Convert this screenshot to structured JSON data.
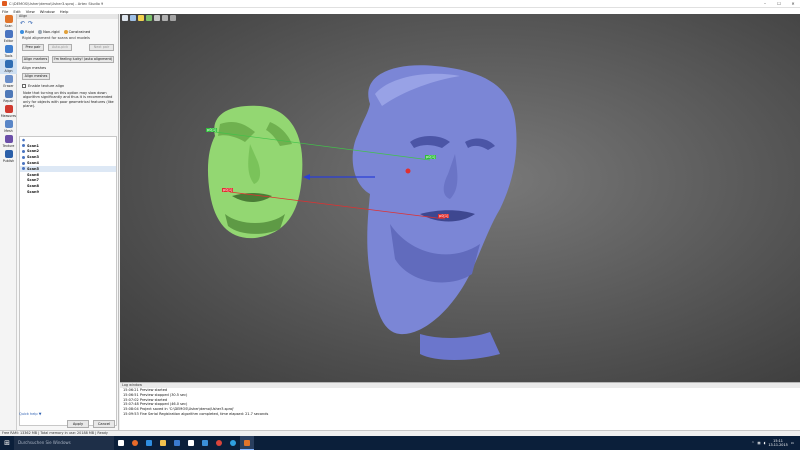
{
  "window": {
    "title": "C:\\DEMOS\\Usher\\demo\\Usher3.sproj - Artec Studio 9",
    "controls": [
      "–",
      "☐",
      "✕"
    ]
  },
  "menu": [
    "File",
    "Edit",
    "View",
    "Window",
    "Help"
  ],
  "tools": [
    {
      "label": "Scan",
      "icon": "scan-icon",
      "color": "#e0742a"
    },
    {
      "label": "Editor",
      "icon": "editor-icon",
      "color": "#4a74c0"
    },
    {
      "label": "Tools",
      "icon": "tools-icon",
      "color": "#3f7fcf"
    },
    {
      "label": "Align",
      "icon": "align-icon",
      "color": "#2f6db3"
    },
    {
      "label": "Eraser",
      "icon": "eraser-icon",
      "color": "#6a8ec9"
    },
    {
      "label": "Repair",
      "icon": "repair-icon",
      "color": "#4f79b8"
    },
    {
      "label": "Measures",
      "icon": "measures-icon",
      "color": "#d13a2f"
    },
    {
      "label": "Mesh",
      "icon": "mesh-icon",
      "color": "#5a86c7"
    },
    {
      "label": "Texture",
      "icon": "texture-icon",
      "color": "#6b4ea8"
    },
    {
      "label": "Publish",
      "icon": "publish-icon",
      "color": "#2b5fa8"
    }
  ],
  "panel": {
    "header": "Align",
    "modes": [
      {
        "label": "Rigid",
        "color": "#3a8ee0"
      },
      {
        "label": "Non-rigid",
        "color": "#9aa7b4"
      },
      {
        "label": "Constrained",
        "color": "#e0a03a"
      }
    ],
    "subtitle": "Rigid alignment for scans and models",
    "pair_buttons": [
      "Prev pair",
      "Auto-pick",
      "Next pair"
    ],
    "align_markers_btn": "Align markers",
    "feeling_lucky_btn": "I'm feeling lucky! (auto alignment)",
    "align_meshes_label": "Align meshes",
    "align_meshes_btn": "Align meshes",
    "texture_align_label": "Enable texture align",
    "note": "Note that turning on this option may slow down algorithm significantly and thus it is recommended only for objects with poor geometrical features (like plane).",
    "tree_header": "●",
    "scans": [
      {
        "name": "Scan1",
        "color": "#4a74c0"
      },
      {
        "name": "Scan2",
        "color": "#4a74c0"
      },
      {
        "name": "Scan3",
        "color": "#4a74c0"
      },
      {
        "name": "Scan4",
        "color": "#4a74c0"
      },
      {
        "name": "Scan5",
        "color": "#4a74c0"
      },
      {
        "name": "Scan6",
        "color": ""
      },
      {
        "name": "Scan7",
        "color": ""
      },
      {
        "name": "Scan8",
        "color": ""
      },
      {
        "name": "Scan9",
        "color": ""
      }
    ],
    "quick_help": "Quick help ▼",
    "apply_btn": "Apply",
    "cancel_btn": "Cancel"
  },
  "viewport": {
    "markers": [
      {
        "label": "p0[1]",
        "color": "#2fbf3a"
      },
      {
        "label": "p0[1]",
        "color": "#e03030"
      },
      {
        "label": "p0[1]",
        "color": "#2fbf3a"
      },
      {
        "label": "p0[1]",
        "color": "#e03030"
      }
    ],
    "left_scan_color": "#93d772",
    "right_scan_color": "#7b86d6"
  },
  "log": {
    "title": "Log window",
    "lines": [
      "15:06:21 Preview started",
      "15:06:51 Preview stopped (30.5 sec)",
      "15:07:02 Preview started",
      "15:07:48 Preview stopped (46.0 sec)",
      "15:08:04 Project saved in 'C:\\DEMOS\\Usher\\demo\\Usher3.sproj'",
      "15:09:53 Fine Serial Registration algorithm completed, time elapsed: 21.7 seconds"
    ]
  },
  "status": "Free RAM: 13362 MB | Total memory in use: 20188 MB | Ready",
  "taskbar": {
    "search_placeholder": "Durchsuchen Sie Windows",
    "apps": [
      {
        "icon": "task-view-icon",
        "color": "#ffffff"
      },
      {
        "icon": "firefox-icon",
        "color": "#e66a2a"
      },
      {
        "icon": "edge-icon",
        "color": "#2f8ee0"
      },
      {
        "icon": "explorer-icon",
        "color": "#f2c14e"
      },
      {
        "icon": "store-icon",
        "color": "#3a7ad0"
      },
      {
        "icon": "photos-icon",
        "color": "#ffffff"
      },
      {
        "icon": "mail-icon",
        "color": "#3b8fd8"
      },
      {
        "icon": "chrome-icon",
        "color": "#d9453b"
      },
      {
        "icon": "skype-icon",
        "color": "#2fa0e0"
      },
      {
        "icon": "artec-icon",
        "color": "#e0742a"
      }
    ],
    "time": "15:11",
    "date": "13.11.2015"
  }
}
